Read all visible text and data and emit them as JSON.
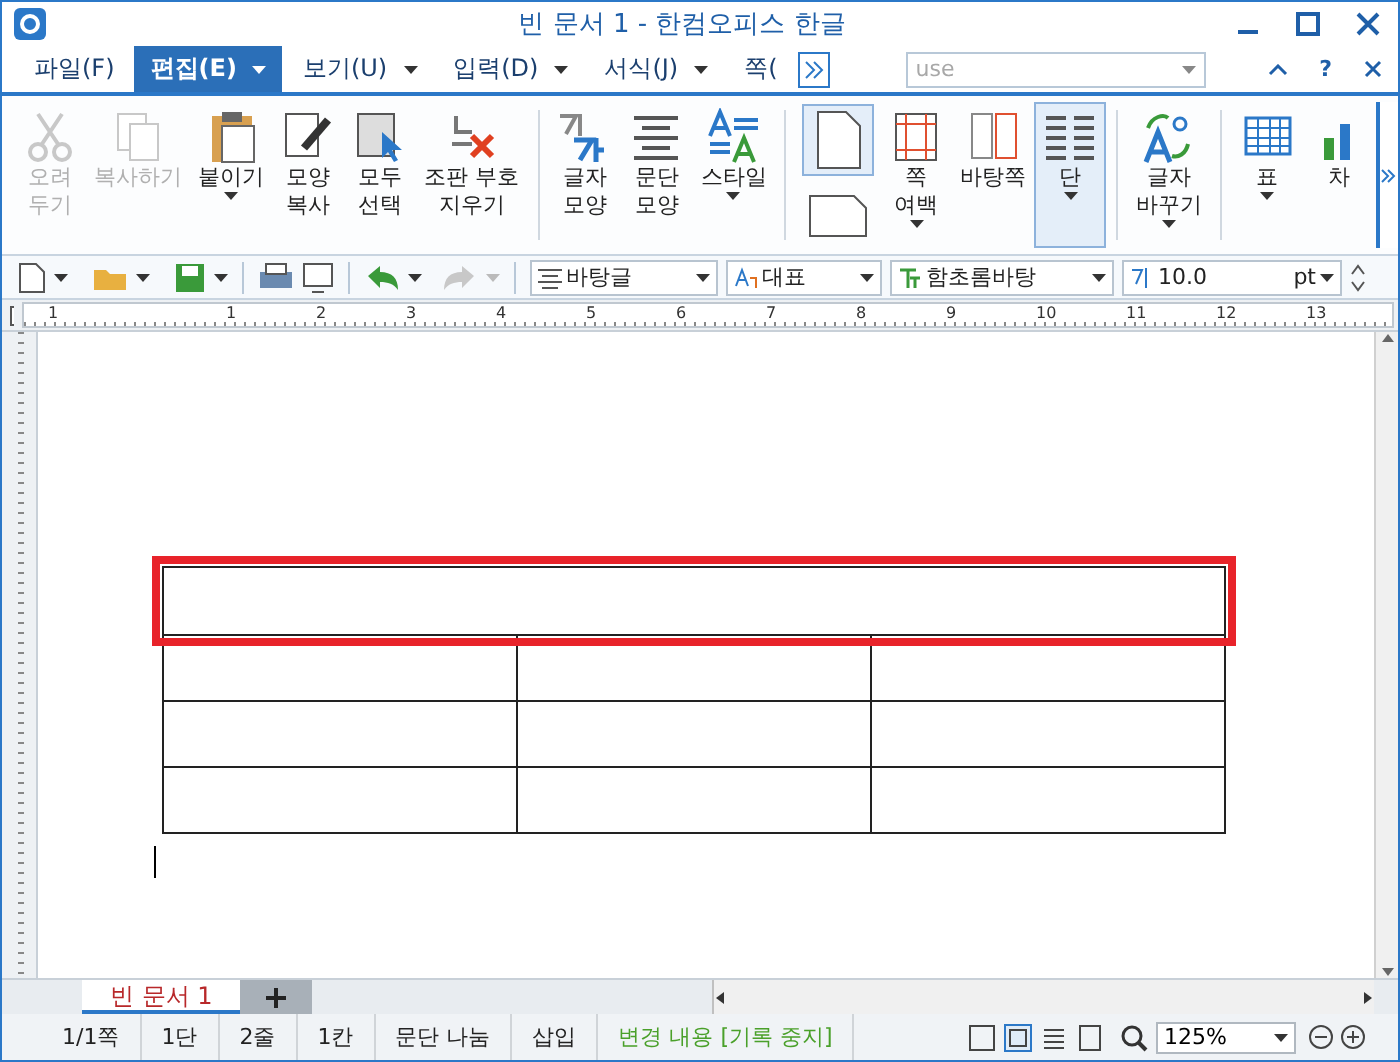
{
  "window": {
    "title": "빈 문서 1 - 한컴오피스 한글"
  },
  "menu": [
    {
      "label": "파일(F)",
      "selected": false,
      "dropdown": false
    },
    {
      "label": "편집(E)",
      "selected": true,
      "dropdown": true
    },
    {
      "label": "보기(U)",
      "selected": false,
      "dropdown": true
    },
    {
      "label": "입력(D)",
      "selected": false,
      "dropdown": true
    },
    {
      "label": "서식(J)",
      "selected": false,
      "dropdown": true
    },
    {
      "label": "쪽(",
      "selected": false,
      "dropdown": false
    }
  ],
  "search": {
    "value": "use"
  },
  "help": "?",
  "ribbon": [
    {
      "kind": "big",
      "label": "오려\n두기",
      "disabled": true,
      "dropdown": false,
      "selected": false
    },
    {
      "kind": "big",
      "label": "복사하기",
      "disabled": true,
      "dropdown": false,
      "selected": false
    },
    {
      "kind": "big",
      "label": "붙이기",
      "disabled": false,
      "dropdown": true,
      "selected": false
    },
    {
      "kind": "big",
      "label": "모양\n복사",
      "disabled": false,
      "dropdown": false,
      "selected": false
    },
    {
      "kind": "big",
      "label": "모두\n선택",
      "disabled": false,
      "dropdown": false,
      "selected": false
    },
    {
      "kind": "big",
      "label": "조판 부호\n지우기",
      "disabled": false,
      "dropdown": false,
      "selected": false
    },
    {
      "kind": "divider"
    },
    {
      "kind": "big",
      "label": "글자\n모양",
      "disabled": false,
      "dropdown": false,
      "selected": false
    },
    {
      "kind": "big",
      "label": "문단\n모양",
      "disabled": false,
      "dropdown": false,
      "selected": false
    },
    {
      "kind": "big",
      "label": "스타일",
      "disabled": false,
      "dropdown": true,
      "selected": false
    },
    {
      "kind": "divider"
    },
    {
      "kind": "stack",
      "selected": true
    },
    {
      "kind": "big",
      "label": "쪽\n여백",
      "disabled": false,
      "dropdown": true,
      "selected": false
    },
    {
      "kind": "big",
      "label": "바탕쪽",
      "disabled": false,
      "dropdown": false,
      "selected": false
    },
    {
      "kind": "big",
      "label": "단",
      "disabled": false,
      "dropdown": true,
      "selected": true
    },
    {
      "kind": "divider"
    },
    {
      "kind": "big",
      "label": "글자\n바꾸기",
      "disabled": false,
      "dropdown": true,
      "selected": false
    },
    {
      "kind": "divider"
    },
    {
      "kind": "big",
      "label": "표",
      "disabled": false,
      "dropdown": true,
      "selected": false
    },
    {
      "kind": "big",
      "label": "차",
      "disabled": false,
      "dropdown": false,
      "selected": false
    }
  ],
  "toolbar": {
    "style": "바탕글",
    "language": "대표",
    "font": "함초롬바탕",
    "size": "10.0",
    "unit": "pt"
  },
  "ruler": {
    "numbers": [
      "1",
      "1",
      "2",
      "3",
      "4",
      "5",
      "6",
      "7",
      "8",
      "9",
      "10",
      "11",
      "12",
      "13"
    ]
  },
  "table": {
    "rows": [
      {
        "merged": true,
        "selected": true
      },
      {
        "merged": false,
        "selected": false
      },
      {
        "merged": false,
        "selected": false
      },
      {
        "merged": false,
        "selected": false
      }
    ]
  },
  "tabs": [
    {
      "label": "빈 문서 1",
      "selected": true
    }
  ],
  "status_bar": {
    "cells": [
      "1/1쪽",
      "1단",
      "2줄",
      "1칸",
      "문단 나눔",
      "삽입"
    ],
    "track_changes": "변경 내용 [기록 중지]",
    "zoom": "125%"
  }
}
